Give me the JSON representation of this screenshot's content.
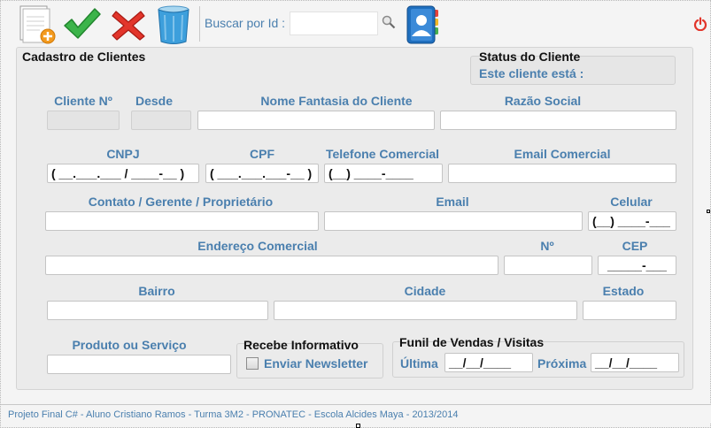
{
  "toolbar": {
    "new_icon": "new-document-icon",
    "confirm_icon": "green-check-icon",
    "cancel_icon": "red-x-icon",
    "delete_icon": "trash-icon",
    "search_label": "Buscar por Id :",
    "search_value": "",
    "search_icon": "magnifier-icon",
    "contacts_icon": "address-book-icon",
    "power_icon": "power-icon"
  },
  "form": {
    "title": "Cadastro de Clientes",
    "status": {
      "title": "Status do Cliente",
      "text": "Este cliente está :"
    },
    "labels": {
      "cliente_no": "Cliente Nº",
      "desde": "Desde",
      "nome_fantasia": "Nome Fantasia do Cliente",
      "razao_social": "Razão Social",
      "cnpj": "CNPJ",
      "cpf": "CPF",
      "telefone": "Telefone Comercial",
      "email_comercial": "Email Comercial",
      "contato": "Contato / Gerente / Proprietário",
      "email": "Email",
      "celular": "Celular",
      "endereco": "Endereço Comercial",
      "numero": "Nº",
      "cep": "CEP",
      "bairro": "Bairro",
      "cidade": "Cidade",
      "estado": "Estado",
      "produto": "Produto ou Serviço"
    },
    "values": {
      "cliente_no": "",
      "desde": "",
      "nome_fantasia": "",
      "razao_social": "",
      "cnpj": "( __.___.___ / ____-__ )",
      "cpf": "( ___.___.___-__ )",
      "telefone": "(__) ____-____",
      "email_comercial": "",
      "contato": "",
      "email": "",
      "celular": "(__) ____-___",
      "endereco": "",
      "numero": "",
      "cep": "_____-___",
      "bairro": "",
      "cidade": "",
      "estado": "",
      "produto": ""
    },
    "newsletter": {
      "title": "Recebe Informativo",
      "label": "Enviar Newsletter",
      "checked": false
    },
    "funil": {
      "title": "Funil de Vendas / Visitas",
      "ultima_label": "Última",
      "ultima_value": "__/__/____",
      "proxima_label": "Próxima",
      "proxima_value": "__/__/____"
    }
  },
  "footer": {
    "text": "Projeto Final C# - Aluno Cristiano Ramos - Turma  3M2 - PRONATEC - Escola Alcides Maya - 2013/2014"
  },
  "colors": {
    "label_blue": "#4a7fae",
    "panel_bg": "#ebebeb",
    "window_bg": "#f4f4f4"
  }
}
